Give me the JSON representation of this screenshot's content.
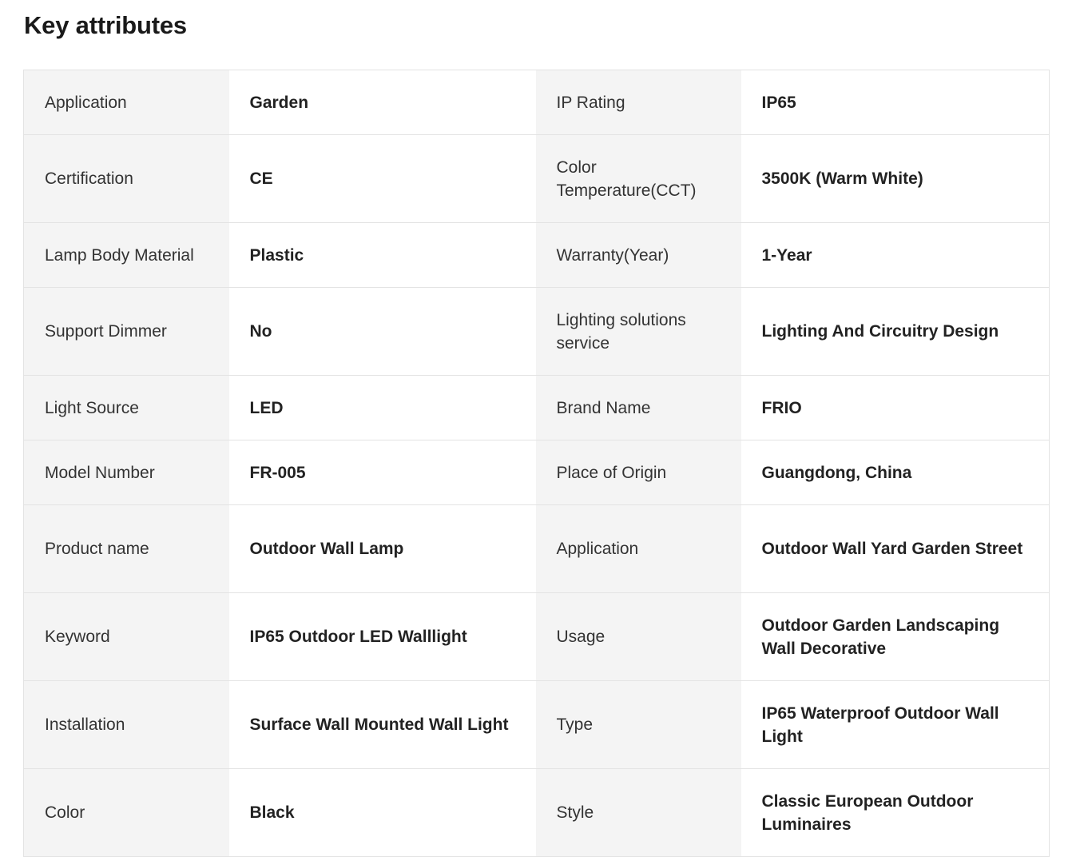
{
  "section": {
    "title": "Key attributes"
  },
  "rows": [
    {
      "label1": "Application",
      "value1": "Garden",
      "label2": "IP Rating",
      "value2": "IP65"
    },
    {
      "label1": "Certification",
      "value1": "CE",
      "label2": "Color Temperature(CCT)",
      "value2": "3500K (Warm White)"
    },
    {
      "label1": "Lamp Body Material",
      "value1": "Plastic",
      "label2": "Warranty(Year)",
      "value2": "1-Year"
    },
    {
      "label1": "Support Dimmer",
      "value1": "No",
      "label2": "Lighting solutions service",
      "value2": "Lighting And Circuitry Design"
    },
    {
      "label1": "Light Source",
      "value1": "LED",
      "label2": "Brand Name",
      "value2": "FRIO"
    },
    {
      "label1": "Model Number",
      "value1": "FR-005",
      "label2": "Place of Origin",
      "value2": "Guangdong, China"
    },
    {
      "label1": "Product name",
      "value1": "Outdoor Wall Lamp",
      "label2": "Application",
      "value2": "Outdoor Wall Yard Garden Street"
    },
    {
      "label1": "Keyword",
      "value1": "IP65 Outdoor LED Walllight",
      "label2": "Usage",
      "value2": "Outdoor Garden Landscaping Wall Decorative"
    },
    {
      "label1": "Installation",
      "value1": "Surface Wall Mounted Wall Light",
      "label2": "Type",
      "value2": "IP65 Waterproof Outdoor Wall Light"
    },
    {
      "label1": "Color",
      "value1": "Black",
      "label2": "Style",
      "value2": "Classic European Outdoor Luminaires"
    }
  ]
}
